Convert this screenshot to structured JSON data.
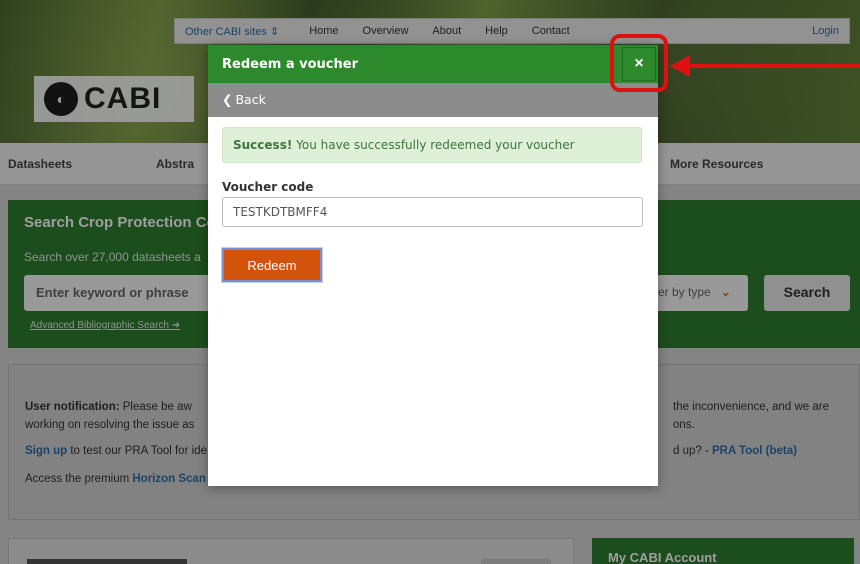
{
  "header": {
    "other_sites": "Other CABI sites",
    "nav": [
      "Home",
      "Overview",
      "About",
      "Help",
      "Contact"
    ],
    "login": "Login",
    "logo_text": "CABI"
  },
  "main_nav": [
    "Datasheets",
    "Abstra",
    "More Resources"
  ],
  "search": {
    "title": "Search Crop Protection Co",
    "subtitle": "Search over 27,000 datasheets a",
    "keyword_placeholder": "Enter keyword or phrase",
    "filter_label": "er by type",
    "search_button": "Search",
    "advanced_link": "Advanced Bibliographic Search"
  },
  "notice": {
    "line1_bold": "User notification:",
    "line1_left": " Please be aw",
    "line1_right": "the inconvenience, and we are",
    "line2_left": "working on resolving the issue as",
    "line2_right": "ons.",
    "line3_link": "Sign up",
    "line3_left": " to test our PRA Tool for ide",
    "line3_right": "d up? - ",
    "line3_right_link": "PRA Tool (beta)",
    "line4_left": "Access the premium ",
    "line4_link": "Horizon Scan"
  },
  "account_title": "My CABI Account",
  "modal": {
    "title": "Redeem a voucher",
    "close_symbol": "×",
    "back_label": "Back",
    "alert_bold": "Success!",
    "alert_text": " You have successfully redeemed your voucher",
    "field_label": "Voucher code",
    "voucher_value": "TESTKDTBMFF4",
    "redeem_label": "Redeem"
  },
  "colors": {
    "header_green": "#2c8a2c",
    "back_bar_grey": "#8c8c8c",
    "success_bg": "#dff0d8",
    "redeem_orange": "#d2530b",
    "annotation_red": "#e01010"
  }
}
